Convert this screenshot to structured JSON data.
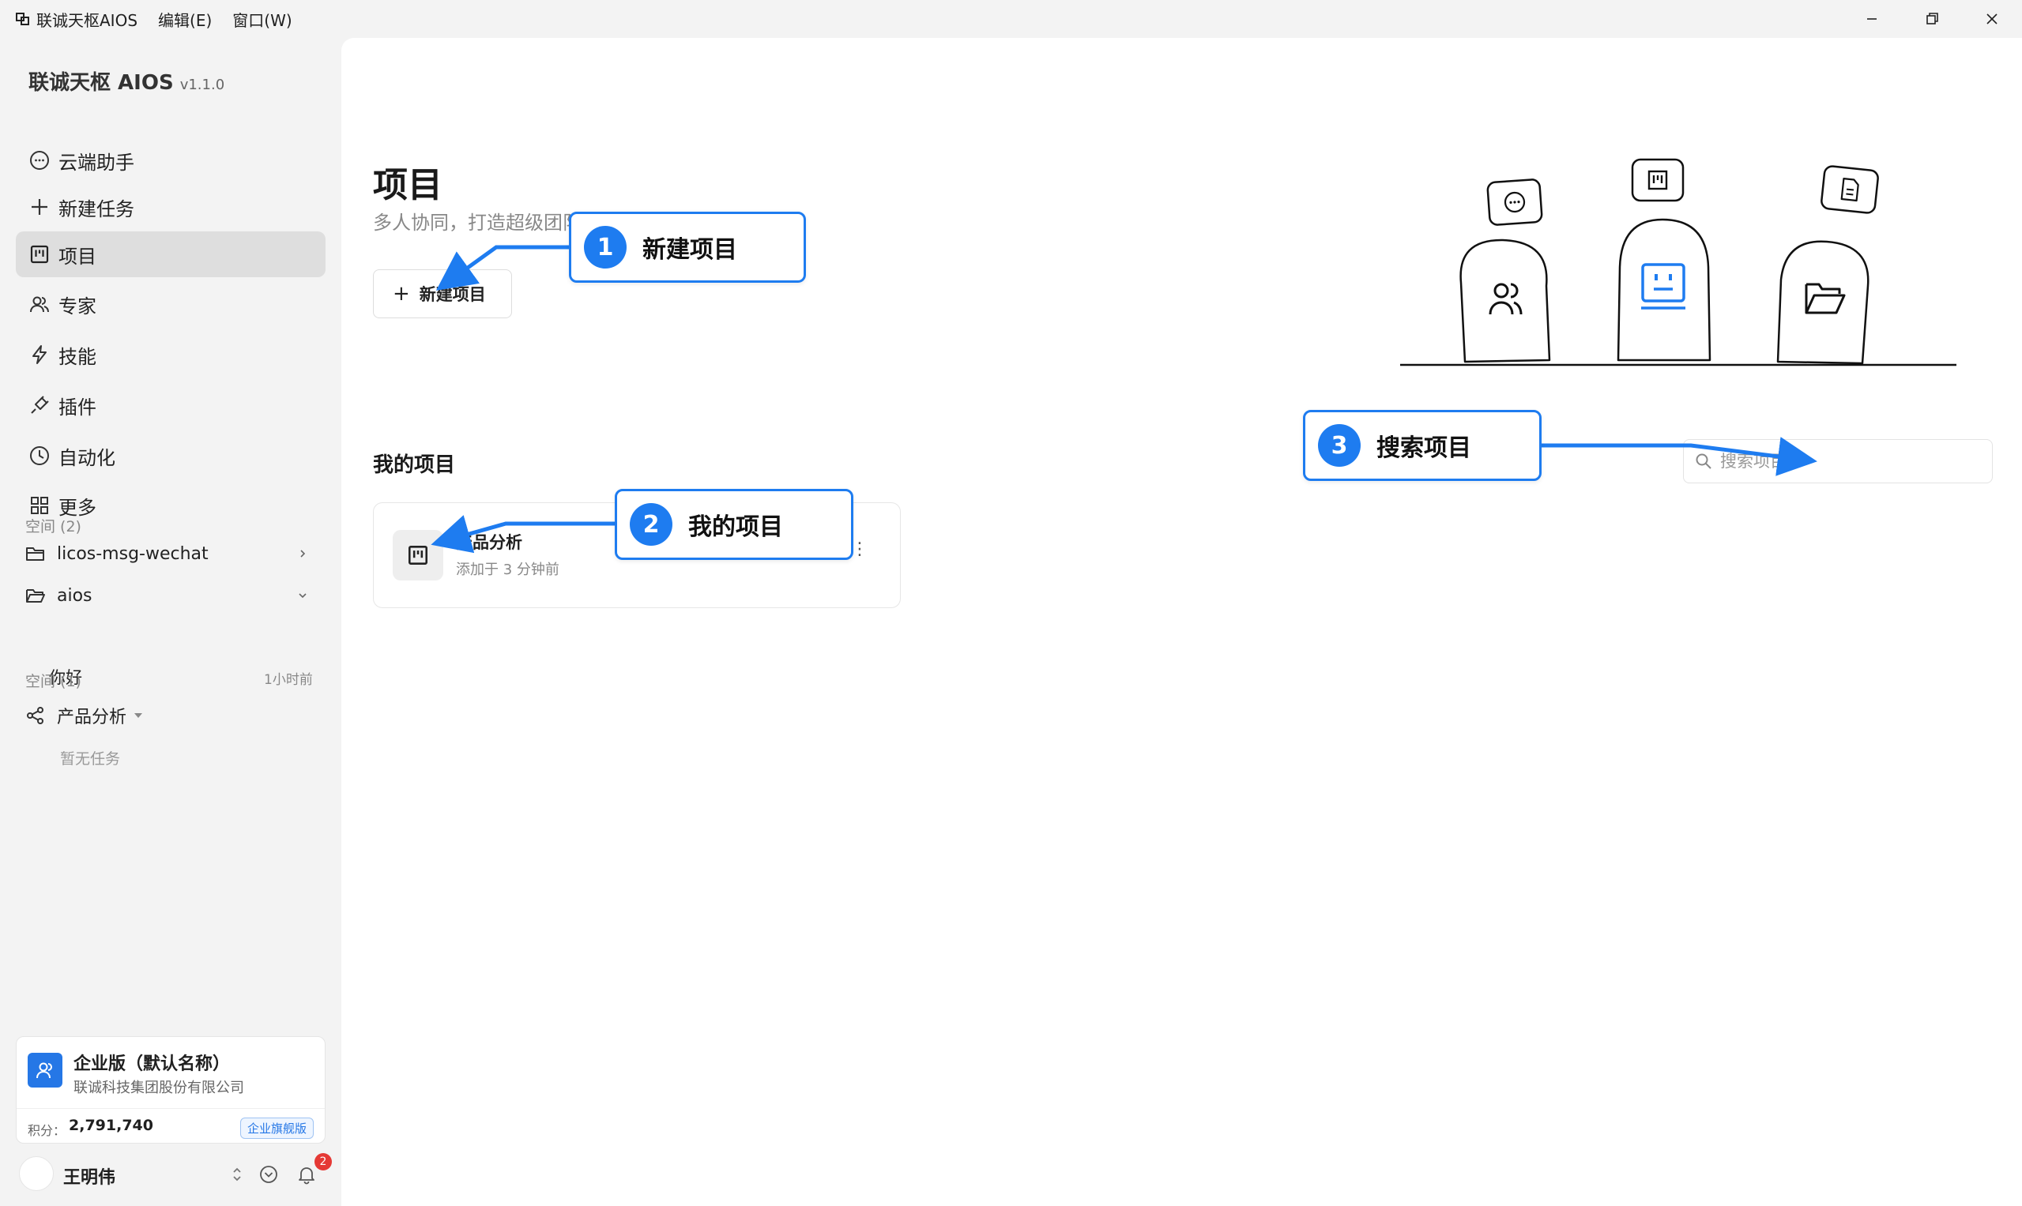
{
  "titlebar": {
    "app_name": "联诚天枢AIOS",
    "menu_edit": "编辑(E)",
    "menu_window": "窗口(W)"
  },
  "sidebar": {
    "brand": "联诚天枢 AIOS",
    "version": "v1.1.0",
    "nav": [
      {
        "label": "云端助手",
        "icon": "chat-icon"
      },
      {
        "label": "新建任务",
        "icon": "plus-icon"
      },
      {
        "label": "项目",
        "icon": "kanban-icon",
        "active": true
      },
      {
        "label": "专家",
        "icon": "users-icon"
      },
      {
        "label": "技能",
        "icon": "lightning-icon"
      },
      {
        "label": "插件",
        "icon": "plug-icon"
      },
      {
        "label": "自动化",
        "icon": "clock-icon"
      },
      {
        "label": "更多",
        "icon": "grid-icon"
      }
    ],
    "space_label_1": "空间 (2)",
    "folders": [
      {
        "name": "licos-msg-wechat"
      },
      {
        "name": "aios"
      }
    ],
    "aios_child": {
      "name": "你好",
      "time": "1小时前"
    },
    "space_label_2": "空间 (1)",
    "project_group": {
      "name": "产品分析",
      "empty": "暂无任务"
    },
    "enterprise": {
      "name": "企业版（默认名称）",
      "org": "联诚科技集团股份有限公司",
      "points_label": "积分：",
      "points": "2,791,740",
      "badge": "企业旗舰版"
    },
    "user": {
      "name": "王明伟",
      "notifications": "2"
    }
  },
  "main": {
    "title": "项目",
    "subtitle": "多人协同，打造超级团队",
    "new_button": "新建项目",
    "section_title": "我的项目",
    "search_placeholder": "搜索项目",
    "projects": [
      {
        "name": "产品分析",
        "time": "添加于 3 分钟前"
      }
    ]
  },
  "callouts": [
    {
      "num": "1",
      "label": "新建项目"
    },
    {
      "num": "2",
      "label": "我的项目"
    },
    {
      "num": "3",
      "label": "搜索项目"
    }
  ],
  "colors": {
    "accent": "#1e7cf0",
    "enterprise_logo": "#2577e6",
    "badge_red": "#e53935",
    "active_nav": "#dedede"
  }
}
